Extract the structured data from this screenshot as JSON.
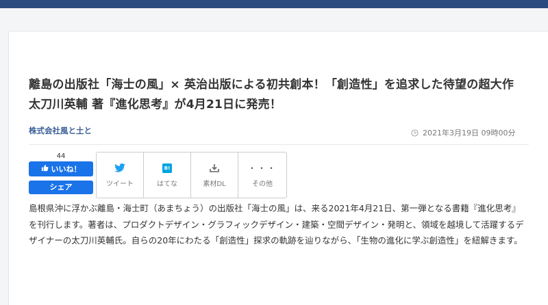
{
  "article": {
    "title": "離島の出版社「海士の風」× 英治出版による初共創本！「創造性」を追求した待望の超大作太刀川英輔 著『進化思考』が4月21日に発売！",
    "company": "株式会社風と土と",
    "date": "2021年3月19日 09時00分",
    "body": "島根県沖に浮かぶ離島・海士町（あまちょう）の出版社「海士の風」は、来る2021年4月21日、第一弾となる書籍『進化思考』を刊行します。著者は、プロダクトデザイン・グラフィックデザイン・建築・空間デザイン・発明と、領域を越境して活躍するデザイナーの太刀川英輔氏。自らの20年にわたる「創造性」探求の軌跡を辿りながら、「生物の進化に学ぶ創造性」を紐解きます。"
  },
  "like": {
    "count": "44",
    "like_label": "いいね！",
    "share_label": "シェア"
  },
  "share": {
    "tweet": "ツイート",
    "hatena": "はてな",
    "download": "素材DL",
    "other": "その他",
    "other_icon_text": "・・・",
    "hatena_icon_text": "B!"
  },
  "icons": {
    "clock": "clock-icon",
    "thumb": "thumbs-up-icon",
    "twitter": "twitter-bird-icon",
    "hatena": "hatena-bookmark-icon",
    "download": "download-icon",
    "more": "more-dots-icon"
  },
  "colors": {
    "header": "#2b4a7e",
    "accent": "#1a73e8",
    "company": "#3a5f99",
    "twitter": "#1da1f2",
    "hatena": "#00a4de"
  }
}
